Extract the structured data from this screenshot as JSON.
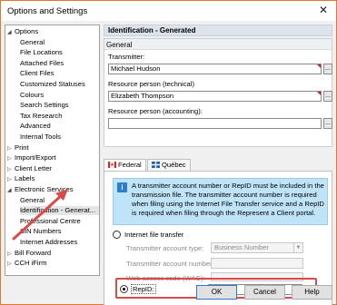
{
  "window": {
    "title": "Options and Settings",
    "close_glyph": "✕"
  },
  "tree": {
    "nodes": [
      {
        "label": "Options",
        "level": 0,
        "expanded": true
      },
      {
        "label": "General",
        "level": 1
      },
      {
        "label": "File Locations",
        "level": 1
      },
      {
        "label": "Attached Files",
        "level": 1
      },
      {
        "label": "Client Files",
        "level": 1
      },
      {
        "label": "Customized Statuses",
        "level": 1
      },
      {
        "label": "Colours",
        "level": 1
      },
      {
        "label": "Search Settings",
        "level": 1
      },
      {
        "label": "Tax Research",
        "level": 1
      },
      {
        "label": "Advanced",
        "level": 1
      },
      {
        "label": "Internal Tools",
        "level": 1
      },
      {
        "label": "Print",
        "level": 0,
        "expanded": false
      },
      {
        "label": "Import/Export",
        "level": 0,
        "expanded": false
      },
      {
        "label": "Client Letter",
        "level": 0,
        "expanded": false
      },
      {
        "label": "Labels",
        "level": 0,
        "expanded": false
      },
      {
        "label": "Electronic Services",
        "level": 0,
        "expanded": true
      },
      {
        "label": "General",
        "level": 1
      },
      {
        "label": "Identification - Generat...",
        "level": 1,
        "selected": true
      },
      {
        "label": "Professional Centre",
        "level": 1
      },
      {
        "label": "SIN Numbers",
        "level": 1
      },
      {
        "label": "Internet Addresses",
        "level": 1
      },
      {
        "label": "Bill Forward",
        "level": 0,
        "expanded": false
      },
      {
        "label": "CCH iFirm",
        "level": 0,
        "expanded": false
      }
    ]
  },
  "panel": {
    "header": "Identification - Generated",
    "section": "General",
    "transmitter_label": "Transmitter:",
    "transmitter_value": "Michael Hudson",
    "tech_label": "Resource person (technical)",
    "tech_value": "Elizabeth Thompson",
    "accounting_label": "Resource person (accounting):",
    "accounting_value": "",
    "dots": "..."
  },
  "tabs": {
    "federal": "Federal",
    "quebec": "Québec"
  },
  "federal": {
    "info_icon": "i",
    "info_text": "A transmitter account number or RepID must be included in the transmission file. The transmitter account number is required when filing using the Internet File Transfer service and a RepID is required when filing through the Represent a Client portal.",
    "internet_file_transfer": "Internet file transfer",
    "account_type_label": "Transmitter account type:",
    "account_type_value": "Business Number",
    "account_number_label": "Transmitter account number:",
    "web_access_label": "Web access code (WAC):",
    "repid_label": "RepID:",
    "repid_value": ""
  },
  "buttons": {
    "ok": "OK",
    "cancel": "Cancel",
    "help": "Help"
  },
  "colors": {
    "window_border": "#e8772e",
    "annotation_red": "#d94b4b",
    "info_bg": "#bfe3f7",
    "info_icon": "#2a7bd2"
  }
}
